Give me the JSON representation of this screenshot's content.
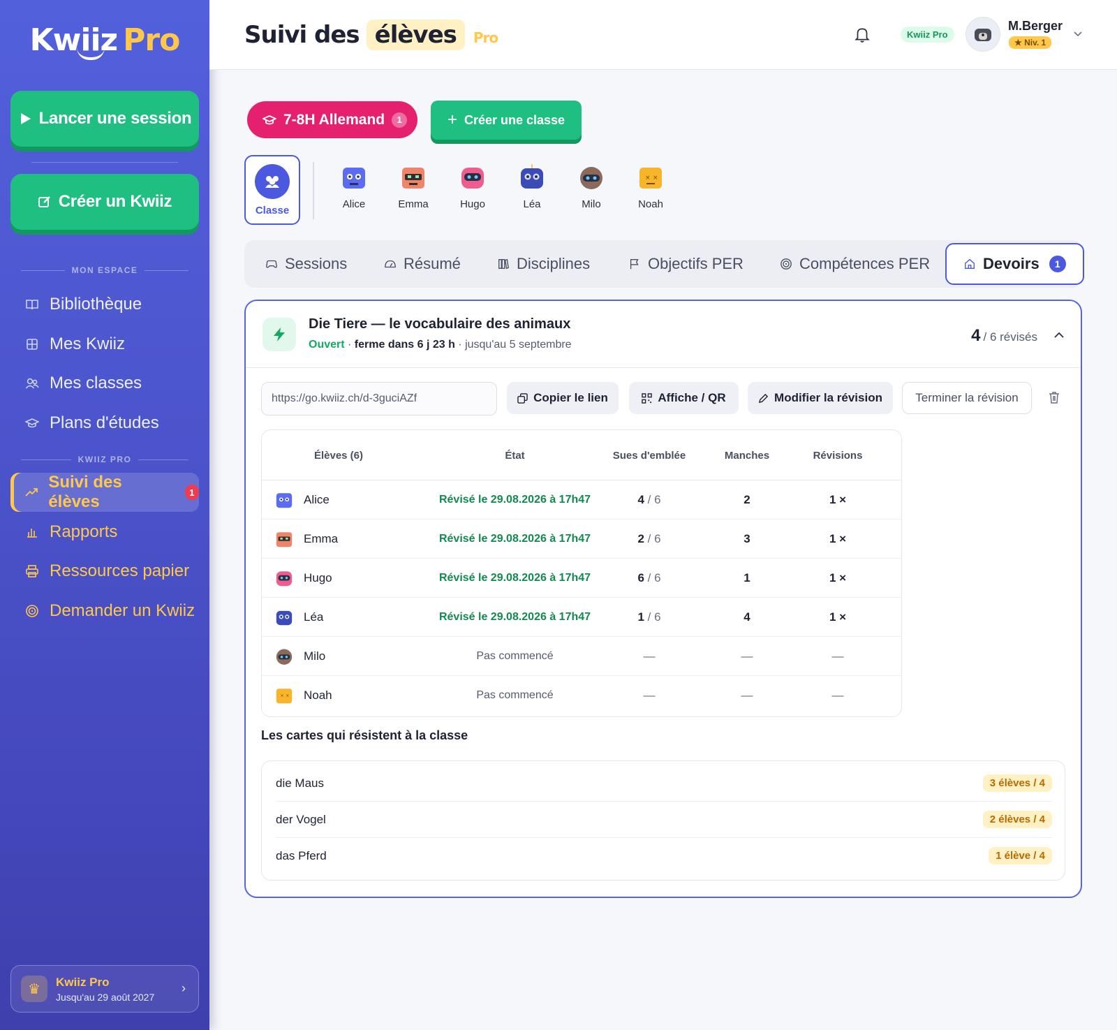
{
  "sidebar": {
    "logo_main": "Kwiiz",
    "logo_pro": "Pro",
    "launch_label": "Lancer une session",
    "create_label": "Créer un Kwiiz",
    "section_space": "MON ESPACE",
    "section_pro": "KWIIZ PRO",
    "items": [
      {
        "label": "Bibliothèque",
        "icon": "book-icon"
      },
      {
        "label": "Mes Kwiiz",
        "icon": "grid-icon"
      },
      {
        "label": "Mes classes",
        "icon": "users-icon"
      },
      {
        "label": "Plans d'études",
        "icon": "graduation-cap-icon"
      }
    ],
    "pro_items": [
      {
        "label": "Suivi des élèves",
        "icon": "trending-up-icon",
        "badge": "1"
      },
      {
        "label": "Rapports",
        "icon": "bar-chart-icon"
      },
      {
        "label": "Ressources papier",
        "icon": "printer-icon"
      },
      {
        "label": "Demander un Kwiiz",
        "icon": "target-icon"
      }
    ],
    "plan": {
      "name": "Kwiiz Pro",
      "until": "Jusqu'au 29 août 2027"
    }
  },
  "header": {
    "title_part1": "Suivi des",
    "title_part2": "élèves",
    "title_tag": "Pro",
    "plan_pill": "Kwiiz Pro",
    "user_name": "M.Berger",
    "level": "★ Niv. 1"
  },
  "classbar": {
    "class_name": "7-8H Allemand",
    "class_count": "1",
    "create_class": "Créer une classe"
  },
  "students": {
    "class_label": "Classe",
    "list": [
      {
        "name": "Alice",
        "color": "#5b6cf0"
      },
      {
        "name": "Emma",
        "color": "#f0846a"
      },
      {
        "name": "Hugo",
        "color": "#ef5d8e"
      },
      {
        "name": "Léa",
        "color": "#3b4bb8"
      },
      {
        "name": "Milo",
        "color": "#8a6a5a"
      },
      {
        "name": "Noah",
        "color": "#f7b52b"
      }
    ]
  },
  "tabs": [
    {
      "label": "Sessions",
      "icon": "gamepad-icon"
    },
    {
      "label": "Résumé",
      "icon": "gauge-icon"
    },
    {
      "label": "Disciplines",
      "icon": "books-icon"
    },
    {
      "label": "Objectifs PER",
      "icon": "flag-icon"
    },
    {
      "label": "Compétences PER",
      "icon": "target-icon"
    },
    {
      "label": "Devoirs",
      "icon": "home-icon",
      "badge": "1"
    }
  ],
  "homework": {
    "title": "Die Tiere — le vocabulaire des animaux",
    "status": "Ouvert",
    "sep1": " · ",
    "closes": "ferme dans 6 j 23 h",
    "sep2": " · ",
    "until": "jusqu'au 5 septembre",
    "revised_count": "4",
    "revised_total": "/ 6 révisés",
    "link": "https://go.kwiiz.ch/d-3guciAZf",
    "actions": {
      "copy": "Copier le lien",
      "display": "Affiche / QR",
      "edit": "Modifier la révision",
      "finish": "Terminer la révision"
    },
    "table": {
      "headers": [
        "Élèves (6)",
        "État",
        "Sues d'emblée",
        "Manches",
        "Révisions"
      ],
      "rows": [
        {
          "name": "Alice",
          "state": "Révisé le 29.08.2026 à 17h47",
          "known": "4",
          "known_total": "/ 6",
          "rounds": "2",
          "revisions": "1 ×",
          "done": true
        },
        {
          "name": "Emma",
          "state": "Révisé le 29.08.2026 à 17h47",
          "known": "2",
          "known_total": "/ 6",
          "rounds": "3",
          "revisions": "1 ×",
          "done": true
        },
        {
          "name": "Hugo",
          "state": "Révisé le 29.08.2026 à 17h47",
          "known": "6",
          "known_total": "/ 6",
          "rounds": "1",
          "revisions": "1 ×",
          "done": true
        },
        {
          "name": "Léa",
          "state": "Révisé le 29.08.2026 à 17h47",
          "known": "1",
          "known_total": "/ 6",
          "rounds": "4",
          "revisions": "1 ×",
          "done": true
        },
        {
          "name": "Milo",
          "state": "Pas commencé",
          "known": "—",
          "known_total": "",
          "rounds": "—",
          "revisions": "—",
          "done": false
        },
        {
          "name": "Noah",
          "state": "Pas commencé",
          "known": "—",
          "known_total": "",
          "rounds": "—",
          "revisions": "—",
          "done": false
        }
      ]
    },
    "hard_title": "Les cartes qui résistent à la classe",
    "hard_cards": [
      {
        "word": "die Maus",
        "count": "3 élèves / 4"
      },
      {
        "word": "der Vogel",
        "count": "2 élèves / 4"
      },
      {
        "word": "das Pferd",
        "count": "1 élève / 4"
      }
    ]
  }
}
